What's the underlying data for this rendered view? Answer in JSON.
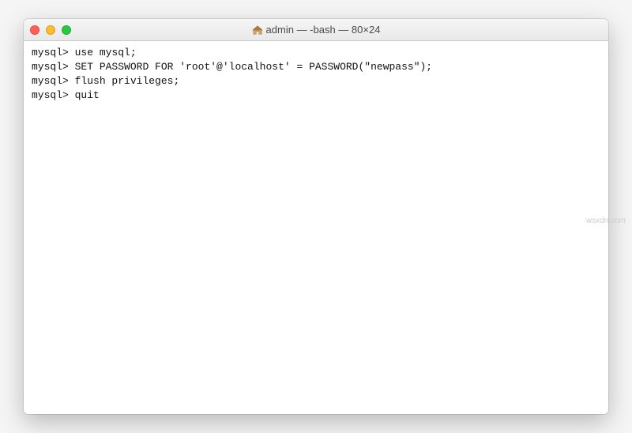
{
  "window": {
    "title": "admin — -bash — 80×24",
    "icon": "home-icon"
  },
  "terminal": {
    "prompt": "mysql>",
    "lines": [
      {
        "prompt": "mysql>",
        "command": "use mysql;"
      },
      {
        "prompt": "mysql>",
        "command": "SET PASSWORD FOR 'root'@'localhost' = PASSWORD(\"newpass\");"
      },
      {
        "prompt": "mysql>",
        "command": "flush privileges;"
      },
      {
        "prompt": "mysql>",
        "command": "quit"
      }
    ]
  },
  "watermark": "wsxdn.com"
}
